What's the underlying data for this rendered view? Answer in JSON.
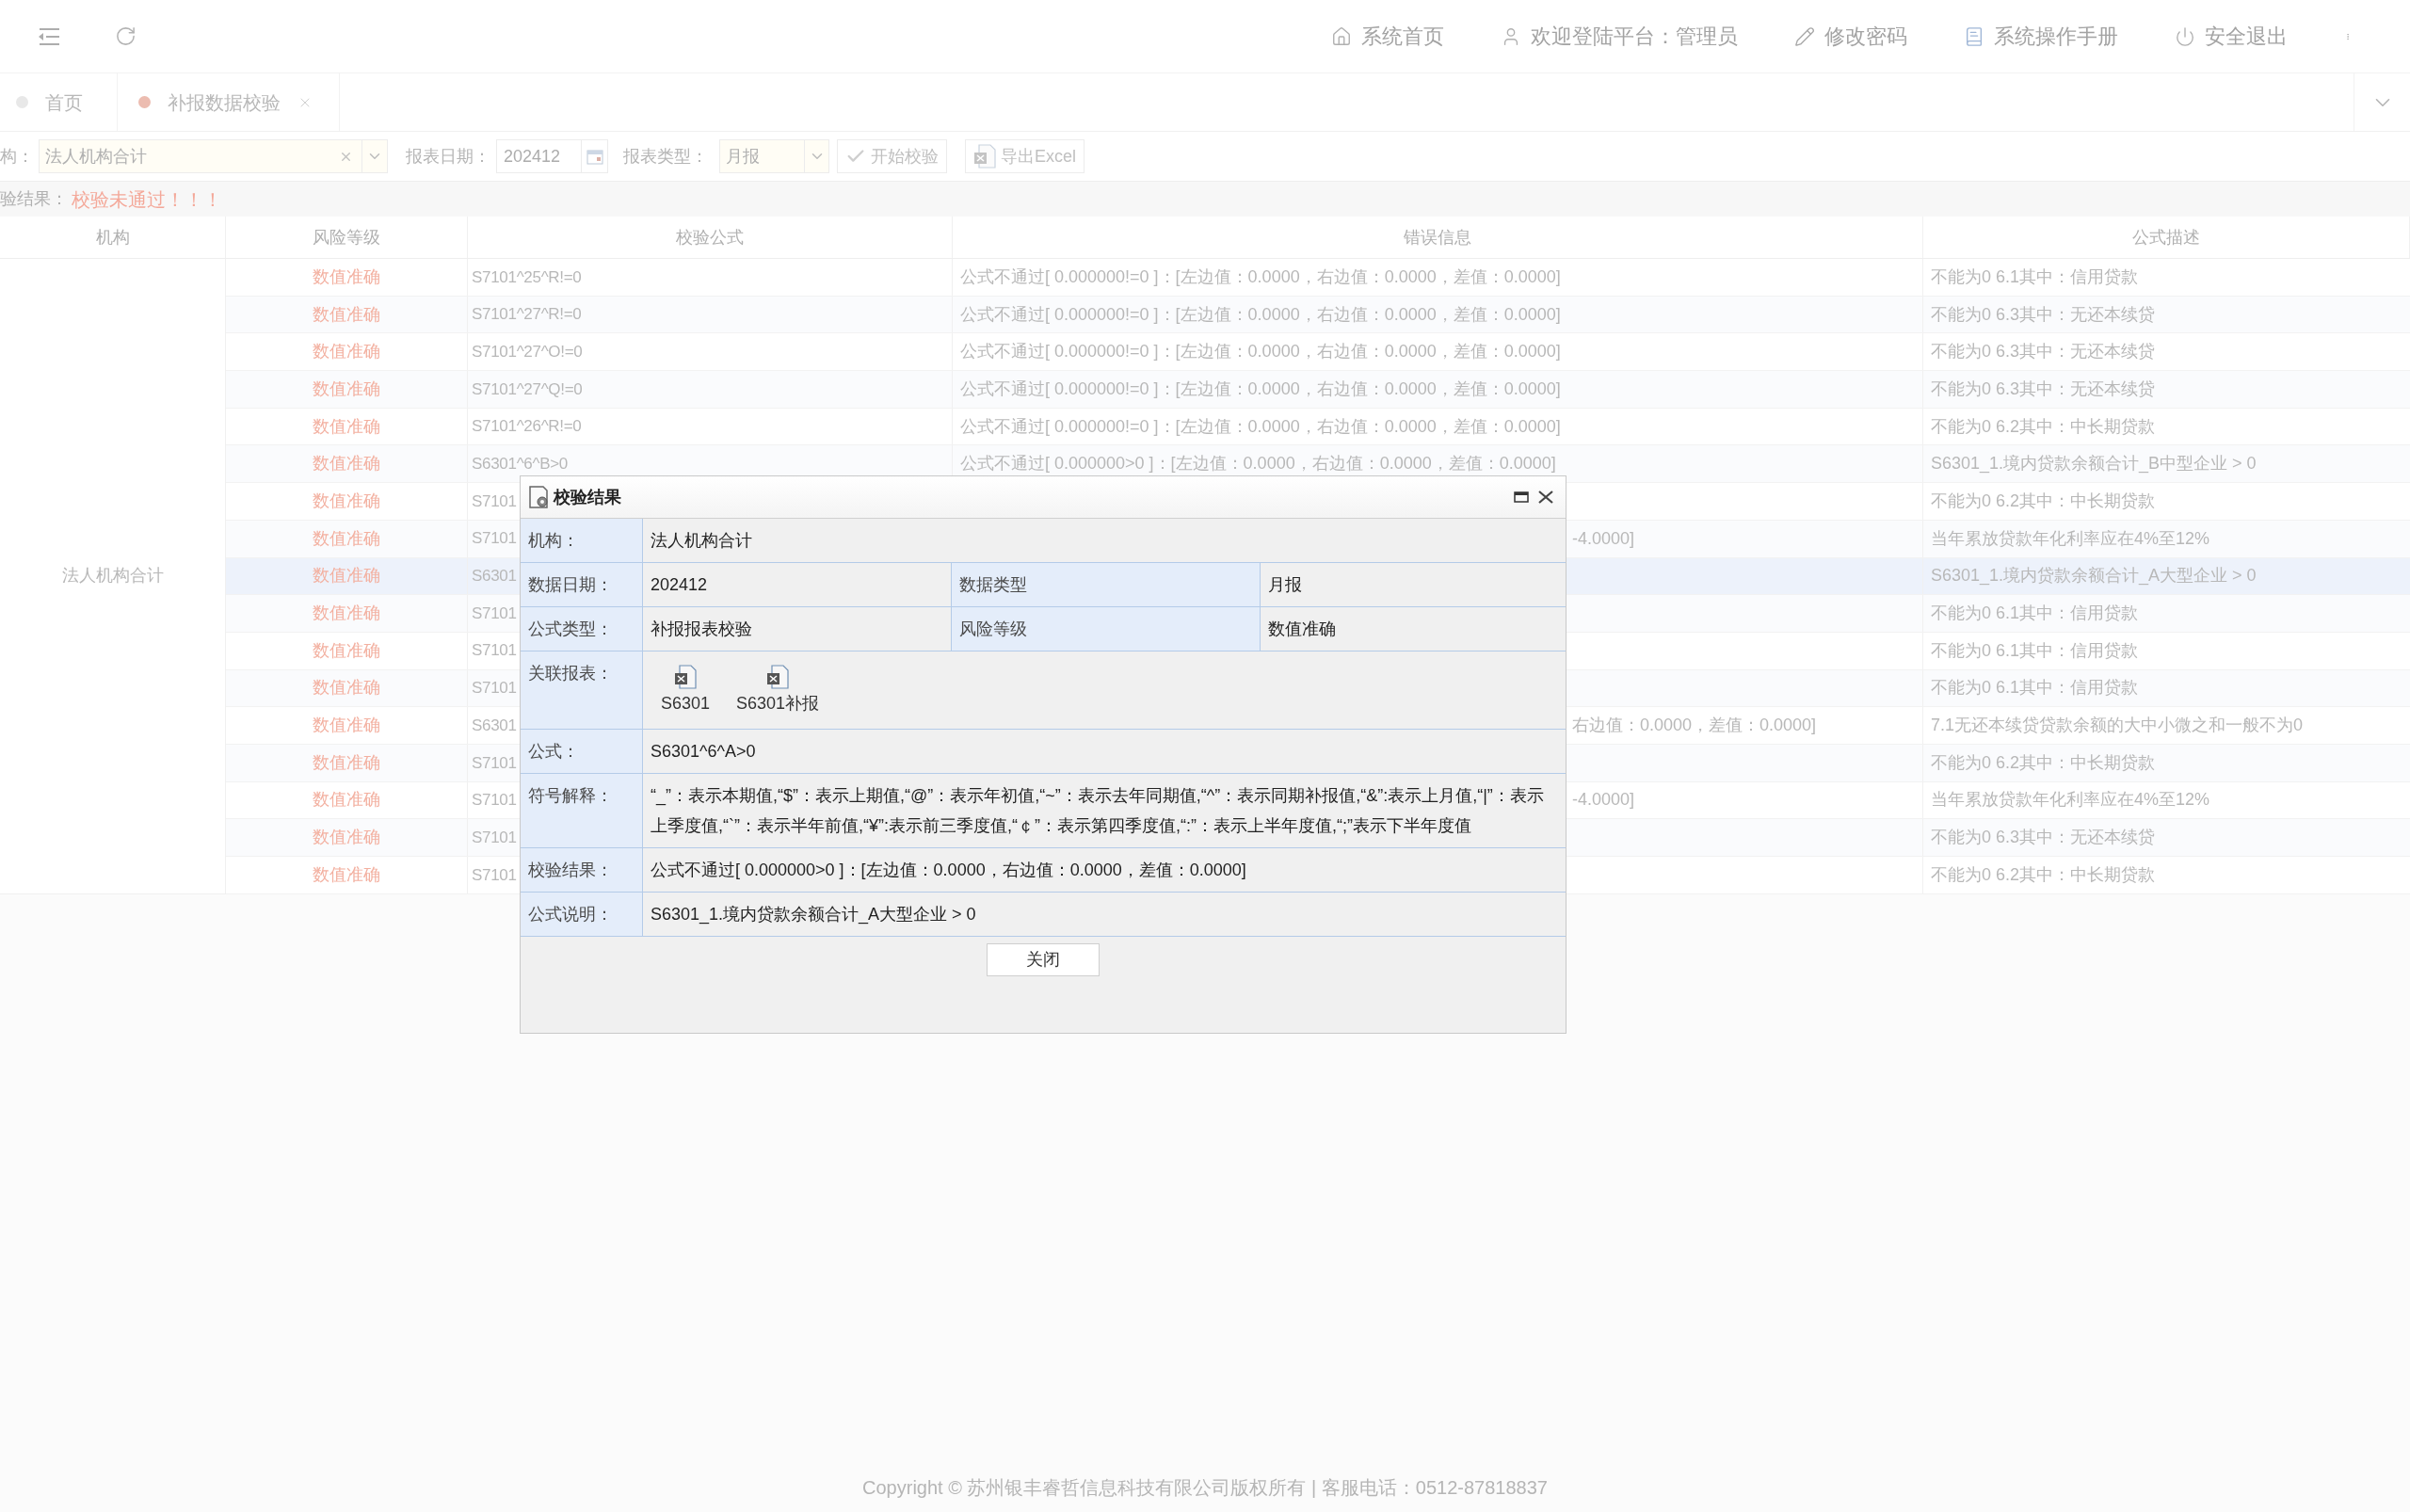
{
  "top_bar": {
    "nav": [
      "系统首页",
      "欢迎登陆平台：管理员",
      "修改密码",
      "系统操作手册",
      "安全退出"
    ]
  },
  "tabs": [
    {
      "label": "首页",
      "selected": false,
      "closable": false
    },
    {
      "label": "补报数据校验",
      "selected": true,
      "closable": true
    }
  ],
  "filters": {
    "org": {
      "label": "构：",
      "value": "法人机构合计"
    },
    "date": {
      "label": "报表日期：",
      "value": "202412"
    },
    "type": {
      "label": "报表类型：",
      "value": "月报"
    },
    "buttons": [
      "开始校验",
      "导出Excel"
    ]
  },
  "result": {
    "label": "验结果：",
    "message": "校验未通过！！！"
  },
  "table": {
    "columns": [
      "机构",
      "风险等级",
      "校验公式",
      "错误信息",
      "公式描述"
    ],
    "org": "法人机构合计",
    "rows": [
      {
        "risk": "数值准确",
        "formula": "S7101^25^R!=0",
        "error": "公式不通过[ 0.000000!=0 ]：[左边值：0.0000，右边值：0.0000，差值：0.0000]",
        "description": "不能为0 6.1其中：信用贷款",
        "selected": false
      },
      {
        "risk": "数值准确",
        "formula": "S7101^27^R!=0",
        "error": "公式不通过[ 0.000000!=0 ]：[左边值：0.0000，右边值：0.0000，差值：0.0000]",
        "description": "不能为0 6.3其中：无还本续贷",
        "selected": false
      },
      {
        "risk": "数值准确",
        "formula": "S7101^27^O!=0",
        "error": "公式不通过[ 0.000000!=0 ]：[左边值：0.0000，右边值：0.0000，差值：0.0000]",
        "description": "不能为0 6.3其中：无还本续贷",
        "selected": false
      },
      {
        "risk": "数值准确",
        "formula": "S7101^27^Q!=0",
        "error": "公式不通过[ 0.000000!=0 ]：[左边值：0.0000，右边值：0.0000，差值：0.0000]",
        "description": "不能为0 6.3其中：无还本续贷",
        "selected": false
      },
      {
        "risk": "数值准确",
        "formula": "S7101^26^R!=0",
        "error": "公式不通过[ 0.000000!=0 ]：[左边值：0.0000，右边值：0.0000，差值：0.0000]",
        "description": "不能为0 6.2其中：中长期贷款",
        "selected": false
      },
      {
        "risk": "数值准确",
        "formula": "S6301^6^B>0",
        "error": "公式不通过[ 0.000000>0 ]：[左边值：0.0000，右边值：0.0000，差值：0.0000]",
        "description": "S6301_1.境内贷款余额合计_B中型企业 > 0",
        "selected": false
      },
      {
        "risk": "数值准确",
        "formula": "S7101",
        "description": "不能为0 6.2其中：中长期贷款",
        "selected": false
      },
      {
        "risk": "数值准确",
        "formula": "S7101",
        "error": "-4.0000]",
        "description": "当年累放贷款年化利率应在4%至12%",
        "selected": false
      },
      {
        "risk": "数值准确",
        "formula": "S6301",
        "description": "S6301_1.境内贷款余额合计_A大型企业 > 0",
        "selected": true
      },
      {
        "risk": "数值准确",
        "formula": "S7101",
        "description": "不能为0 6.1其中：信用贷款",
        "selected": false
      },
      {
        "risk": "数值准确",
        "formula": "S7101",
        "description": "不能为0 6.1其中：信用贷款",
        "selected": false
      },
      {
        "risk": "数值准确",
        "formula": "S7101",
        "description": "不能为0 6.1其中：信用贷款",
        "selected": false
      },
      {
        "risk": "数值准确",
        "formula": "S6301",
        "error": "右边值：0.0000，差值：0.0000]",
        "description": "7.1无还本续贷贷款余额的大中小微之和一般不为0",
        "selected": false
      },
      {
        "risk": "数值准确",
        "formula": "S7101",
        "description": "不能为0 6.2其中：中长期贷款",
        "selected": false
      },
      {
        "risk": "数值准确",
        "formula": "S7101",
        "error": "-4.0000]",
        "description": "当年累放贷款年化利率应在4%至12%",
        "selected": false
      },
      {
        "risk": "数值准确",
        "formula": "S7101",
        "description": "不能为0 6.3其中：无还本续贷",
        "selected": false
      },
      {
        "risk": "数值准确",
        "formula": "S7101",
        "description": "不能为0 6.2其中：中长期贷款",
        "selected": false
      }
    ]
  },
  "dialog": {
    "title": "校验结果",
    "rows": [
      {
        "kind": "single",
        "label": "机构：",
        "value": "法人机构合计"
      },
      {
        "kind": "pair",
        "label": "数据日期：",
        "value": "202412",
        "label_2": "数据类型",
        "value_2": "月报"
      },
      {
        "kind": "pair",
        "label": "公式类型：",
        "value": "补报报表校验",
        "label_2": "风险等级",
        "value_2": "数值准确"
      },
      {
        "kind": "files",
        "label": "关联报表：",
        "files": [
          "S6301",
          "S6301补报"
        ]
      },
      {
        "kind": "single",
        "label": "公式：",
        "value": "S6301^6^A>0"
      },
      {
        "kind": "single",
        "label": "符号解释：",
        "value": "“_”：表示本期值,“$”：表示上期值,“@”：表示年初值,“~”：表示去年同期值,“^”：表示同期补报值,“&”:表示上月值,“|”：表示上季度值,“`”：表示半年前值,“¥”:表示前三季度值,“￠”：表示第四季度值,“:”：表示上半年度值,“;”表示下半年度值"
      },
      {
        "kind": "single",
        "label": "校验结果：",
        "value": "公式不通过[ 0.000000>0 ]：[左边值：0.0000，右边值：0.0000，差值：0.0000]"
      },
      {
        "kind": "single",
        "label": "公式说明：",
        "value": "S6301_1.境内贷款余额合计_A大型企业 > 0"
      }
    ],
    "close_button": "关闭"
  },
  "footer": "Copyright © 苏州银丰睿哲信息科技有限公司版权所有 | 客服电话：0512-87818837"
}
